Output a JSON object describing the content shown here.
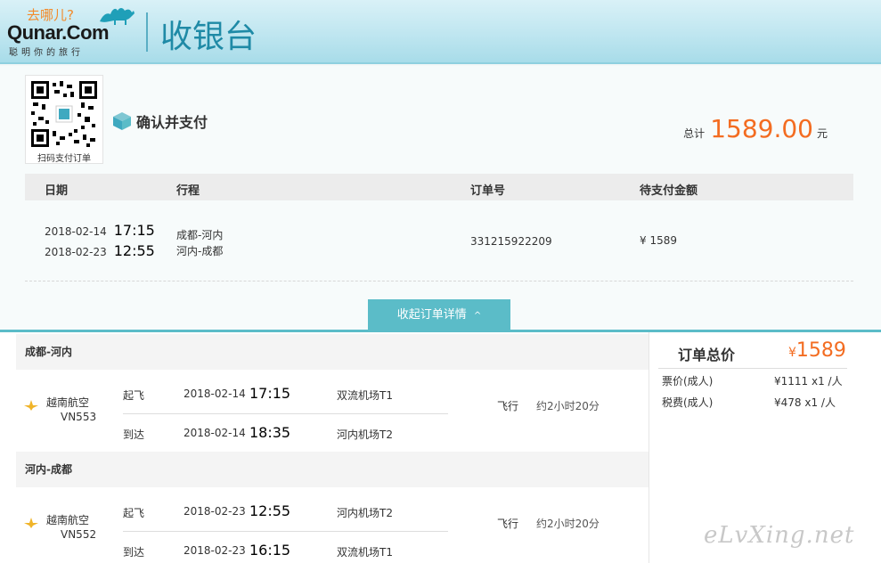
{
  "header": {
    "logo_slogan_top": "去哪儿?",
    "logo_brand": "Qunar.Com",
    "logo_slogan_bottom": "聪明你的旅行",
    "title": "收银台"
  },
  "qr": {
    "caption": "扫码支付订单"
  },
  "confirm": {
    "label": "确认并支付"
  },
  "total": {
    "label": "总计",
    "value": "1589.00",
    "unit": "元"
  },
  "order_table": {
    "columns": [
      "日期",
      "行程",
      "订单号",
      "待支付金额"
    ],
    "row": {
      "dates": [
        {
          "date": "2018-02-14",
          "time": "17:15"
        },
        {
          "date": "2018-02-23",
          "time": "12:55"
        }
      ],
      "routes": [
        "成都-河内",
        "河内-成都"
      ],
      "order_no": "331215922209",
      "amount": "¥ 1589"
    }
  },
  "collapse_button": {
    "label": "收起订单详情",
    "chevron": "^"
  },
  "segments": [
    {
      "title": "成都-河内",
      "airline": "越南航空",
      "flight_no": "VN553",
      "depart": {
        "label": "起飞",
        "date": "2018-02-14",
        "time": "17:15",
        "airport": "双流机场T1"
      },
      "arrive": {
        "label": "到达",
        "date": "2018-02-14",
        "time": "18:35",
        "airport": "河内机场T2"
      },
      "fly_label": "飞行",
      "duration": "约2小时20分"
    },
    {
      "title": "河内-成都",
      "airline": "越南航空",
      "flight_no": "VN552",
      "depart": {
        "label": "起飞",
        "date": "2018-02-23",
        "time": "12:55",
        "airport": "河内机场T2"
      },
      "arrive": {
        "label": "到达",
        "date": "2018-02-23",
        "time": "16:15",
        "airport": "双流机场T1"
      },
      "fly_label": "飞行",
      "duration": "约2小时20分"
    }
  ],
  "price_panel": {
    "title": "订单总价",
    "currency": "¥",
    "total": "1589",
    "rows": [
      {
        "label": "票价(成人)",
        "value": "¥1111 x1 /人"
      },
      {
        "label": "税费(成人)",
        "value": "¥478 x1 /人"
      }
    ]
  },
  "watermark": "eLvXing.net",
  "colors": {
    "accent": "#5bbcc8",
    "price": "#f36c21",
    "title": "#1f8aa6"
  }
}
